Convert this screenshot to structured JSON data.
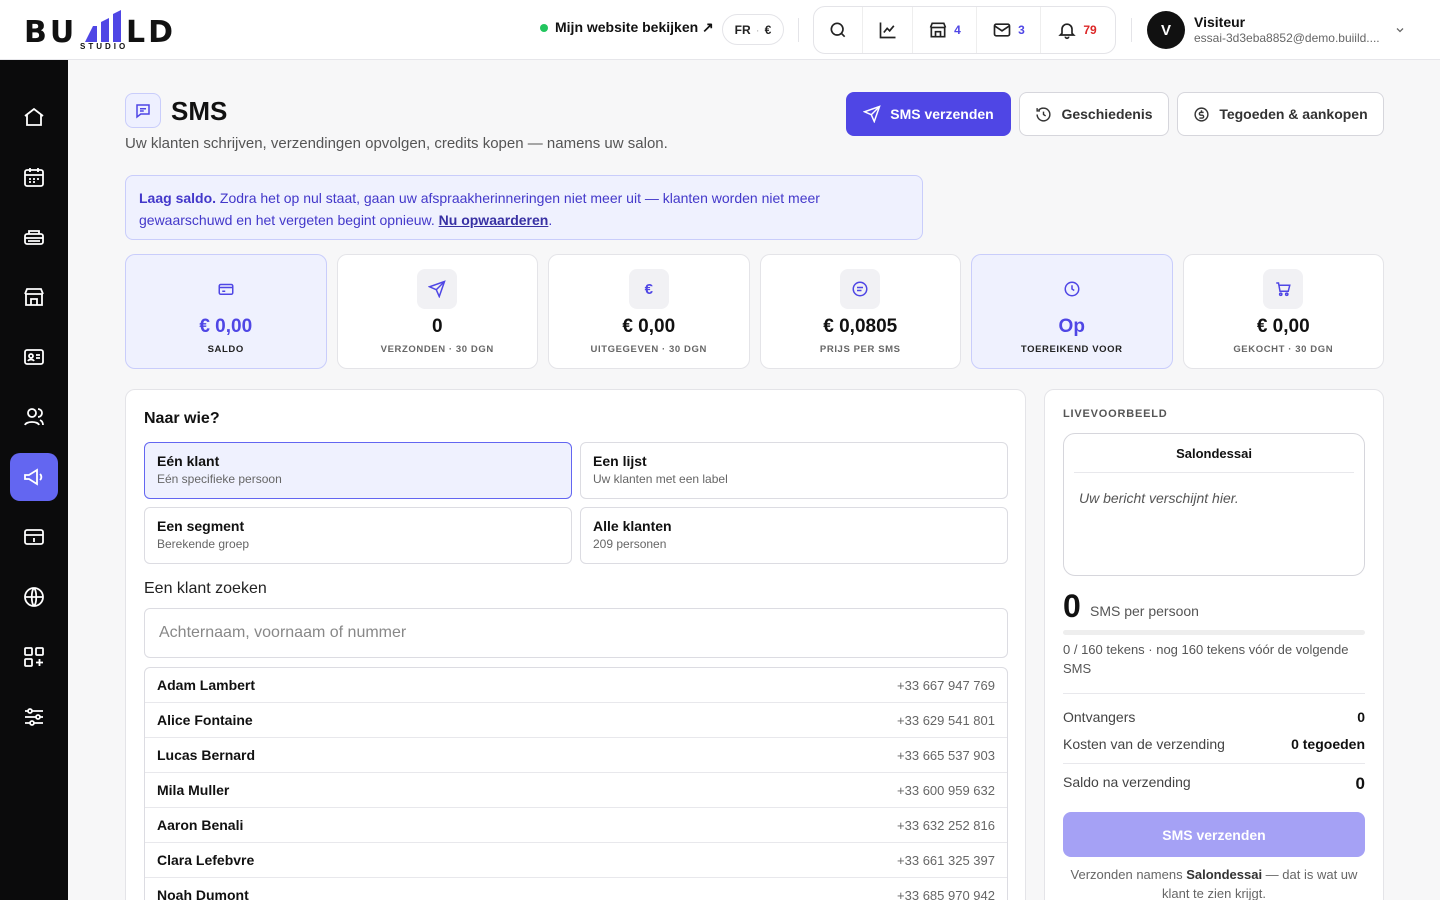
{
  "brand": {
    "logo_text": "BUILD",
    "logo_sub": "STUDIO"
  },
  "topbar": {
    "website_link": "Mijn website bekijken ↗",
    "lang": "FR",
    "currency": "€",
    "counts": {
      "shop": "4",
      "mail": "3",
      "notifications": "79"
    },
    "user": {
      "initial": "V",
      "name": "Visiteur",
      "email": "essai-3d3eba8852@demo.buiild...."
    }
  },
  "sidebar": {
    "items": [
      "home-icon",
      "calendar-icon",
      "services-icon",
      "store-icon",
      "contact-card-icon",
      "clients-icon",
      "megaphone-icon",
      "payments-icon",
      "globe-icon",
      "apps-icon",
      "settings-icon"
    ],
    "active": "megaphone-icon",
    "accent": "#6366f1"
  },
  "page": {
    "title": "SMS",
    "subtitle": "Uw klanten schrijven, verzendingen opvolgen, credits kopen — namens uw salon.",
    "actions": {
      "send": "SMS verzenden",
      "history": "Geschiedenis",
      "credits": "Tegoeden & aankopen"
    }
  },
  "alert": {
    "bold": "Laag saldo.",
    "text": " Zodra het op nul staat, gaan uw afspraakherinneringen niet meer uit — klanten worden niet meer gewaarschuwd en het vergeten begint opnieuw. ",
    "link": "Nu opwaarderen",
    "end": "."
  },
  "stats": [
    {
      "icon": "card-icon",
      "value": "€ 0,00",
      "label": "SALDO",
      "highlight": true
    },
    {
      "icon": "send-icon",
      "value": "0",
      "label": "VERZONDEN · 30 DGN",
      "highlight": false
    },
    {
      "icon": "euro-icon",
      "value": "€ 0,00",
      "label": "UITGEGEVEN · 30 DGN",
      "highlight": false
    },
    {
      "icon": "message-icon",
      "value": "€ 0,0805",
      "label": "PRIJS PER SMS",
      "highlight": false
    },
    {
      "icon": "clock-icon",
      "value": "Op",
      "label": "TOEREIKEND VOOR",
      "highlight": true
    },
    {
      "icon": "cart-icon",
      "value": "€ 0,00",
      "label": "GEKOCHT · 30 DGN",
      "highlight": false
    }
  ],
  "recipients": {
    "heading": "Naar wie?",
    "options": [
      {
        "title": "Eén klant",
        "sub": "Eén specifieke persoon"
      },
      {
        "title": "Een lijst",
        "sub": "Uw klanten met een label"
      },
      {
        "title": "Een segment",
        "sub": "Berekende groep"
      },
      {
        "title": "Alle klanten",
        "sub": "209 personen"
      }
    ],
    "search_label": "Een klant zoeken",
    "search_placeholder": "Achternaam, voornaam of nummer",
    "clients": [
      {
        "name": "Adam Lambert",
        "phone": "+33 667 947 769"
      },
      {
        "name": "Alice Fontaine",
        "phone": "+33 629 541 801"
      },
      {
        "name": "Lucas Bernard",
        "phone": "+33 665 537 903"
      },
      {
        "name": "Mila Muller",
        "phone": "+33 600 959 632"
      },
      {
        "name": "Aaron Benali",
        "phone": "+33 632 252 816"
      },
      {
        "name": "Clara Lefebvre",
        "phone": "+33 661 325 397"
      },
      {
        "name": "Noah Dumont",
        "phone": "+33 685 970 942"
      }
    ]
  },
  "preview": {
    "heading": "LIVEVOORBEELD",
    "sender": "Salondessai",
    "placeholder": "Uw bericht verschijnt hier.",
    "sms_count": "0",
    "sms_count_label": "SMS per persoon",
    "char_progress": 0,
    "chars_text": "0 / 160 tekens · nog 160 tekens vóór de volgende SMS",
    "recipients_label": "Ontvangers",
    "recipients_value": "0",
    "cost_label": "Kosten van de verzending",
    "cost_value": "0 tegoeden",
    "balance_label": "Saldo na verzending",
    "balance_value": "0",
    "send_button": "SMS verzenden",
    "note_pre": "Verzonden namens ",
    "note_bold": "Salondessai",
    "note_post": " — dat is wat uw klant te zien krijgt."
  }
}
